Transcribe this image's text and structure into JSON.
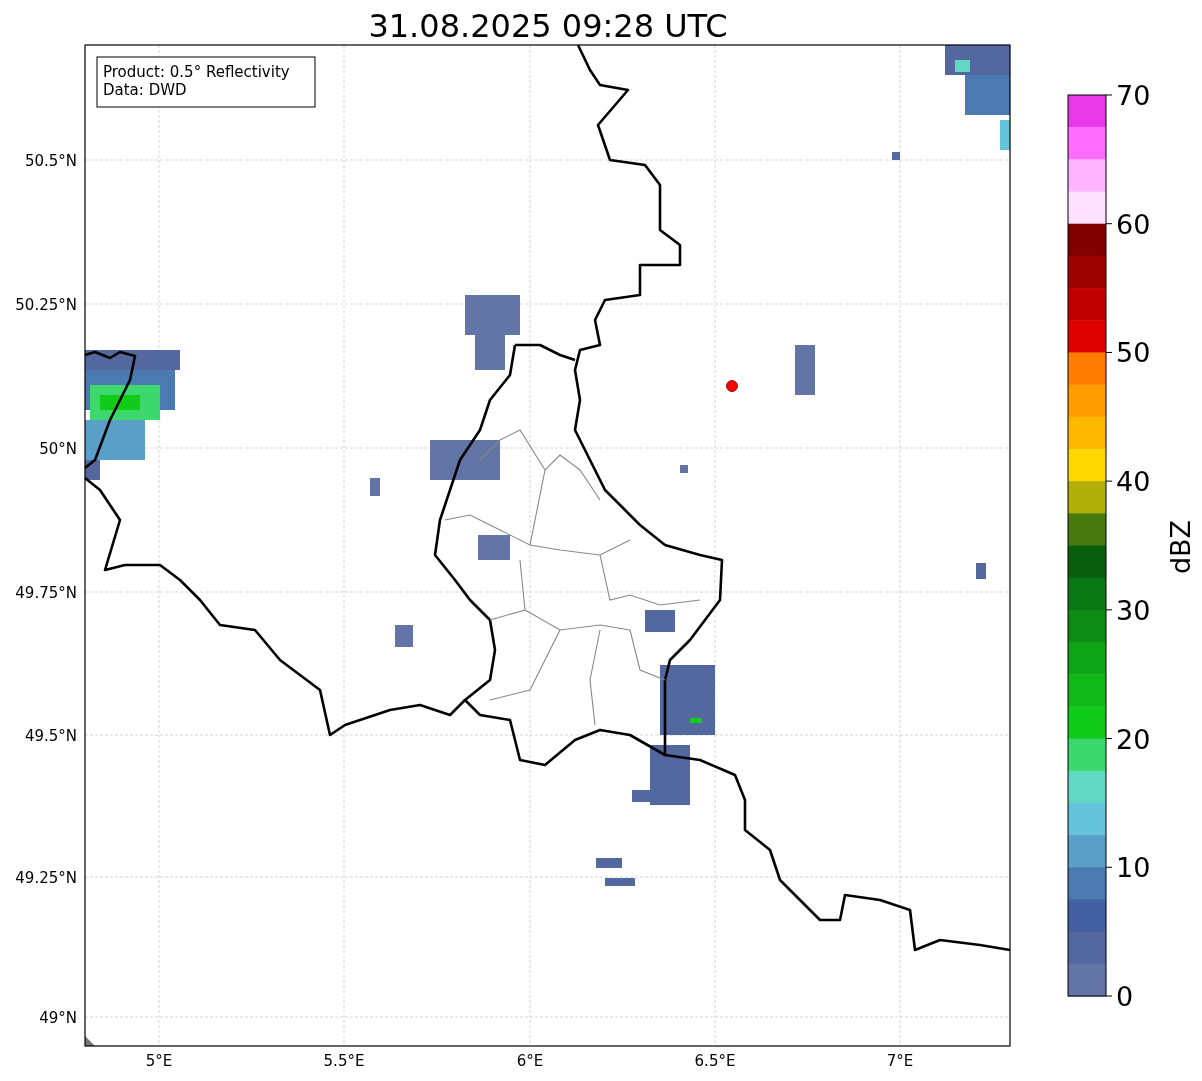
{
  "title": "31.08.2025 09:28 UTC",
  "info_box": {
    "lines": [
      "Product: 0.5° Reflectivity",
      "Data: DWD"
    ]
  },
  "latitude_labels": [
    "50.5°N",
    "50.25°N",
    "50°N",
    "49.75°N",
    "49.5°N",
    "49.25°N",
    "49°N"
  ],
  "longitude_labels": [
    "5°E",
    "5.5°E",
    "6°E",
    "6.5°E",
    "7°E"
  ],
  "colorbar": {
    "label": "dBZ",
    "tick_labels": [
      "70",
      "60",
      "50",
      "40",
      "30",
      "20",
      "10",
      "0"
    ],
    "bands": [
      {
        "color": "#e838e8"
      },
      {
        "color": "#ff6cff"
      },
      {
        "color": "#ffb4ff"
      },
      {
        "color": "#ffe0ff"
      },
      {
        "color": "#800000"
      },
      {
        "color": "#a00000"
      },
      {
        "color": "#c00000"
      },
      {
        "color": "#e00000"
      },
      {
        "color": "#ff7c00"
      },
      {
        "color": "#ff9c00"
      },
      {
        "color": "#ffb800"
      },
      {
        "color": "#ffd800"
      },
      {
        "color": "#b0b008"
      },
      {
        "color": "#487a10"
      },
      {
        "color": "#085e0c"
      },
      {
        "color": "#0a7814"
      },
      {
        "color": "#0c8c14"
      },
      {
        "color": "#10a418"
      },
      {
        "color": "#10b818"
      },
      {
        "color": "#10cc18"
      },
      {
        "color": "#3cd86e"
      },
      {
        "color": "#60d8c4"
      },
      {
        "color": "#66c3dc"
      },
      {
        "color": "#5a9fc8"
      },
      {
        "color": "#4a7ab0"
      },
      {
        "color": "#4560a2"
      },
      {
        "color": "#5468a0"
      },
      {
        "color": "#6374a6"
      }
    ]
  }
}
